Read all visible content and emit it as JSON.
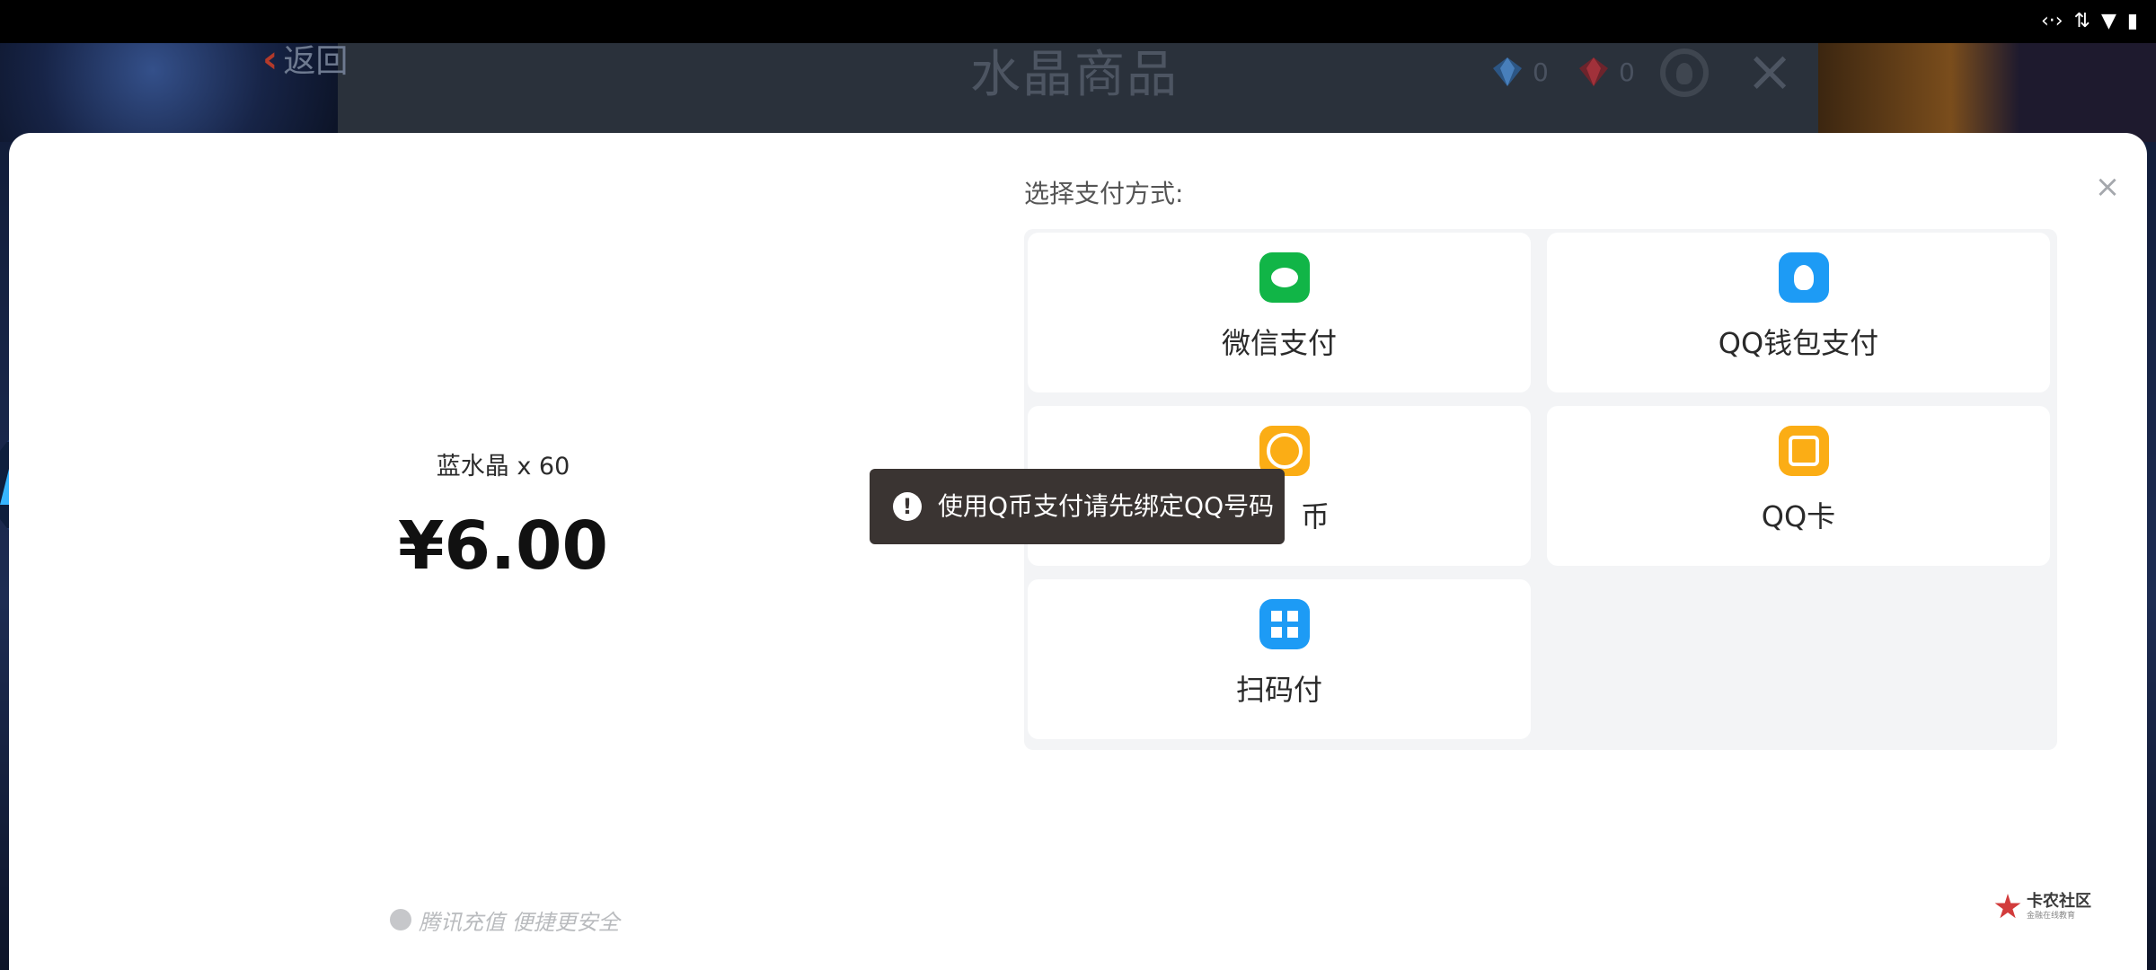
{
  "status_bar": {
    "icons": [
      "data-transfer-icon",
      "signal-arrows-icon",
      "wifi-icon",
      "battery-icon"
    ]
  },
  "shop_header": {
    "back_label": "返回",
    "title": "水晶商品",
    "blue_crystal_count": "0",
    "red_crystal_count": "0"
  },
  "product": {
    "name": "蓝水晶 x 60",
    "price": "¥6.00"
  },
  "payment": {
    "label": "选择支付方式:",
    "options": [
      {
        "label": "微信支付",
        "icon": "wechat-icon",
        "color": "#11b547"
      },
      {
        "label": "QQ钱包支付",
        "icon": "qq-wallet-icon",
        "color": "#1d9bf5"
      },
      {
        "label": "币",
        "icon": "q-coin-icon",
        "color": "#fbad15"
      },
      {
        "label": "QQ卡",
        "icon": "qq-card-icon",
        "color": "#fbad15"
      },
      {
        "label": "扫码付",
        "icon": "scan-code-icon",
        "color": "#1d9bf5"
      }
    ]
  },
  "toast": {
    "message": "使用Q币支付请先绑定QQ号码"
  },
  "footer": {
    "text": "腾讯充值 便捷更安全"
  },
  "watermark": {
    "main": "卡农社区",
    "sub": "金融在线教育"
  }
}
